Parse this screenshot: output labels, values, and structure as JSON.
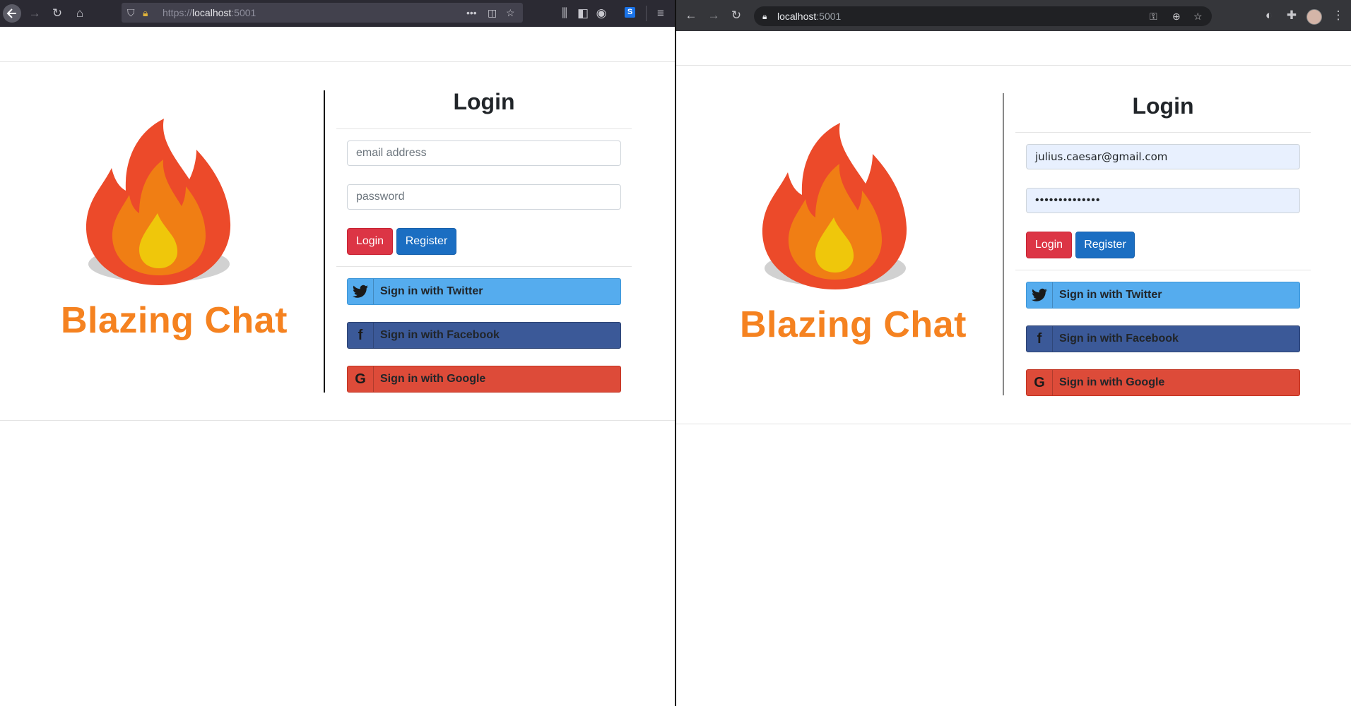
{
  "left": {
    "browser": {
      "url_scheme": "https://",
      "url_host": "localhost",
      "url_port": ":5001",
      "icons": [
        "back-icon",
        "forward-icon",
        "reload-icon",
        "home-icon",
        "shield-icon",
        "warning-lock-icon",
        "more-icon",
        "pocket-icon",
        "bookmark-star-icon",
        "library-icon",
        "sidebar-icon",
        "account-icon",
        "extension-s-icon",
        "menu-icon"
      ]
    },
    "page": {
      "brand": "Blazing Chat",
      "login_title": "Login",
      "email_placeholder": "email address",
      "password_placeholder": "password",
      "login_button": "Login",
      "register_button": "Register",
      "twitter_button": "Sign in with Twitter",
      "facebook_button": "Sign in with Facebook",
      "google_button": "Sign in with Google"
    }
  },
  "right": {
    "browser": {
      "url_host": "localhost",
      "url_port": ":5001",
      "icons": [
        "back-icon",
        "forward-icon",
        "reload-icon",
        "lock-icon",
        "key-icon",
        "add-icon",
        "bookmark-star-icon",
        "extension-icon",
        "puzzle-icon",
        "avatar",
        "kebab-menu-icon"
      ]
    },
    "page": {
      "brand": "Blazing Chat",
      "login_title": "Login",
      "email_value": "julius.caesar@gmail.com",
      "password_value": "••••••••••••••",
      "login_button": "Login",
      "register_button": "Register",
      "twitter_button": "Sign in with Twitter",
      "facebook_button": "Sign in with Facebook",
      "google_button": "Sign in with Google"
    }
  },
  "colors": {
    "brand": "#f58220",
    "login": "#dc3545",
    "register": "#1b6ec2",
    "twitter": "#55acee",
    "facebook": "#3b5998",
    "google": "#dd4b39"
  }
}
